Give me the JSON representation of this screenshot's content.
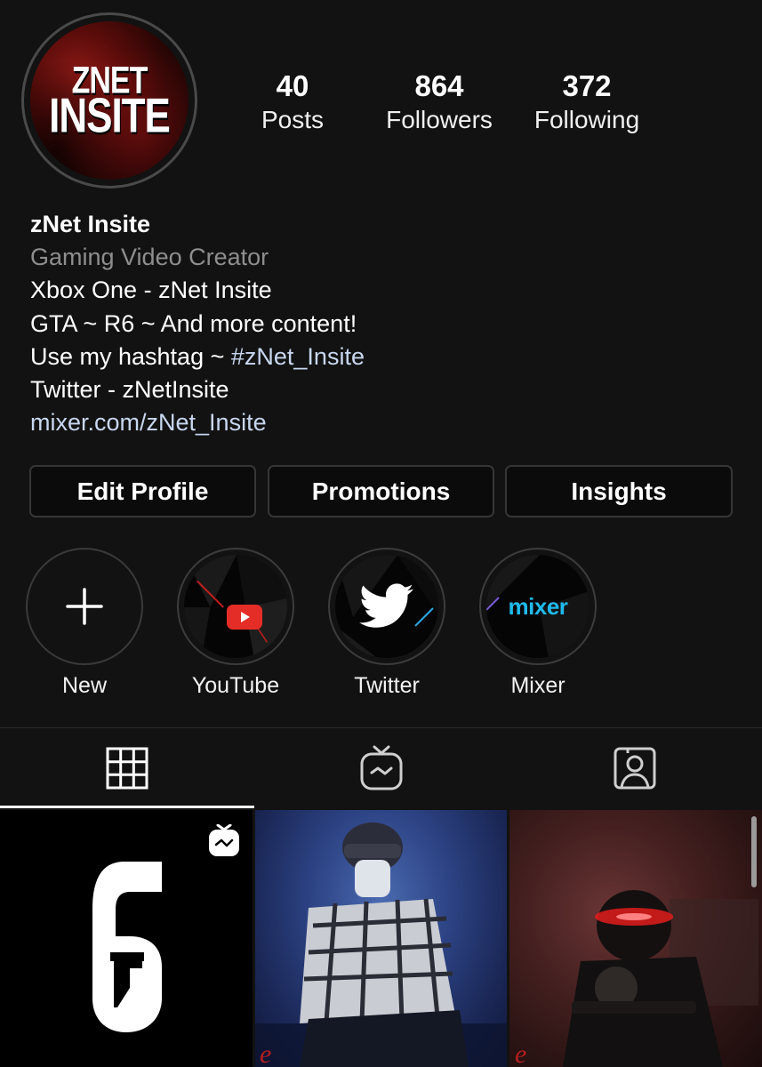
{
  "profile": {
    "avatar_logo_line1": "ZNET",
    "avatar_logo_line2": "INSITE",
    "stats": [
      {
        "value": "40",
        "label": "Posts"
      },
      {
        "value": "864",
        "label": "Followers"
      },
      {
        "value": "372",
        "label": "Following"
      }
    ]
  },
  "bio": {
    "name": "zNet Insite",
    "category": "Gaming Video Creator",
    "line1": "Xbox One - zNet Insite",
    "line2": "GTA ~ R6 ~ And more content!",
    "line3_prefix": "Use my hashtag ~ ",
    "line3_hashtag": "#zNet_Insite",
    "line4": "Twitter - zNetInsite",
    "link": "mixer.com/zNet_Insite"
  },
  "buttons": {
    "edit_profile": "Edit Profile",
    "promotions": "Promotions",
    "insights": "Insights"
  },
  "highlights": [
    {
      "label": "New",
      "icon": "plus-icon"
    },
    {
      "label": "YouTube",
      "icon": "youtube-icon"
    },
    {
      "label": "Twitter",
      "icon": "twitter-bird-icon"
    },
    {
      "label": "Mixer",
      "icon": "mixer-logo-icon",
      "logo_text": "mixer"
    }
  ],
  "tabs": [
    {
      "name": "grid",
      "icon": "grid-icon",
      "active": true
    },
    {
      "name": "igtv",
      "icon": "igtv-icon",
      "active": false
    },
    {
      "name": "tagged",
      "icon": "tagged-person-icon",
      "active": false
    }
  ],
  "posts": [
    {
      "type": "igtv-video",
      "badge_icon": "igtv-icon",
      "art": "rainbow-six-logo"
    },
    {
      "type": "photo",
      "art": "masked-character-plaid-shirt"
    },
    {
      "type": "photo",
      "art": "dark-character-red-eyes"
    }
  ],
  "colors": {
    "background": "#121212",
    "link": "#c8d7ef",
    "secondary_text": "#8e8e8e",
    "youtube_red": "#e52d27",
    "mixer_blue": "#1fbaed"
  }
}
